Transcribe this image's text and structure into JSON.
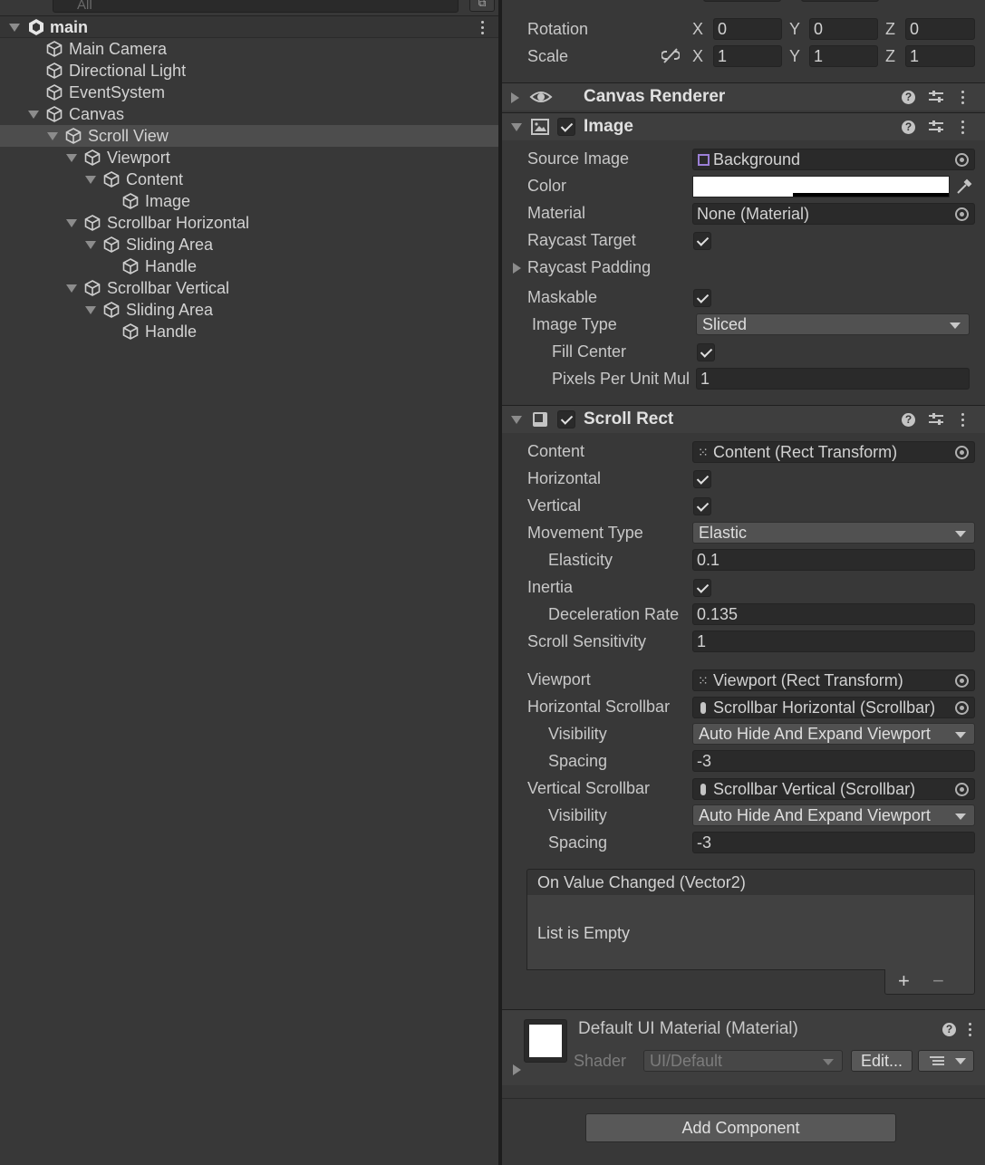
{
  "hierarchy": {
    "search_placeholder": "All",
    "scene": "main",
    "items": [
      {
        "label": "Main Camera"
      },
      {
        "label": "Directional Light"
      },
      {
        "label": "EventSystem"
      },
      {
        "label": "Canvas"
      },
      {
        "label": "Scroll View"
      },
      {
        "label": "Viewport"
      },
      {
        "label": "Content"
      },
      {
        "label": "Image"
      },
      {
        "label": "Scrollbar Horizontal"
      },
      {
        "label": "Sliding Area"
      },
      {
        "label": "Handle"
      },
      {
        "label": "Scrollbar Vertical"
      },
      {
        "label": "Sliding Area"
      },
      {
        "label": "Handle"
      }
    ]
  },
  "inspector": {
    "transform": {
      "rotation_label": "Rotation",
      "scale_label": "Scale",
      "axis_x": "X",
      "axis_y": "Y",
      "axis_z": "Z",
      "rotation": {
        "x": "0",
        "y": "0",
        "z": "0"
      },
      "scale": {
        "x": "1",
        "y": "1",
        "z": "1"
      }
    },
    "canvas_renderer": {
      "title": "Canvas Renderer"
    },
    "image": {
      "title": "Image",
      "source_image_label": "Source Image",
      "source_image_value": "Background",
      "color_label": "Color",
      "color_value": "#ffffff",
      "material_label": "Material",
      "material_value": "None (Material)",
      "raycast_target_label": "Raycast Target",
      "raycast_target": true,
      "raycast_padding_label": "Raycast Padding",
      "maskable_label": "Maskable",
      "maskable": true,
      "image_type_label": "Image Type",
      "image_type_value": "Sliced",
      "fill_center_label": "Fill Center",
      "fill_center": true,
      "ppu_label": "Pixels Per Unit Mul",
      "ppu_value": "1"
    },
    "scroll_rect": {
      "title": "Scroll Rect",
      "content_label": "Content",
      "content_value": "Content (Rect Transform)",
      "horizontal_label": "Horizontal",
      "horizontal": true,
      "vertical_label": "Vertical",
      "vertical": true,
      "movement_type_label": "Movement Type",
      "movement_type_value": "Elastic",
      "elasticity_label": "Elasticity",
      "elasticity_value": "0.1",
      "inertia_label": "Inertia",
      "inertia": true,
      "deceleration_label": "Deceleration Rate",
      "deceleration_value": "0.135",
      "scroll_sensitivity_label": "Scroll Sensitivity",
      "scroll_sensitivity_value": "1",
      "viewport_label": "Viewport",
      "viewport_value": "Viewport (Rect Transform)",
      "hscroll_label": "Horizontal Scrollbar",
      "hscroll_value": "Scrollbar Horizontal (Scrollbar)",
      "hvis_label": "Visibility",
      "hvis_value": "Auto Hide And Expand Viewport",
      "hspacing_label": "Spacing",
      "hspacing_value": "-3",
      "vscroll_label": "Vertical Scrollbar",
      "vscroll_value": "Scrollbar Vertical (Scrollbar)",
      "vvis_label": "Visibility",
      "vvis_value": "Auto Hide And Expand Viewport",
      "vspacing_label": "Spacing",
      "vspacing_value": "-3",
      "event_title": "On Value Changed (Vector2)",
      "event_empty": "List is Empty",
      "event_add": "+",
      "event_remove": "−"
    },
    "material": {
      "title": "Default UI Material (Material)",
      "shader_label": "Shader",
      "shader_value": "UI/Default",
      "edit_label": "Edit..."
    },
    "add_component_label": "Add Component",
    "help_glyph": "?"
  },
  "colors": {
    "panel_bg": "#383838",
    "field_bg": "#2a2a2a",
    "selected_row": "#4d4d4d",
    "text": "#d2d2d2"
  }
}
